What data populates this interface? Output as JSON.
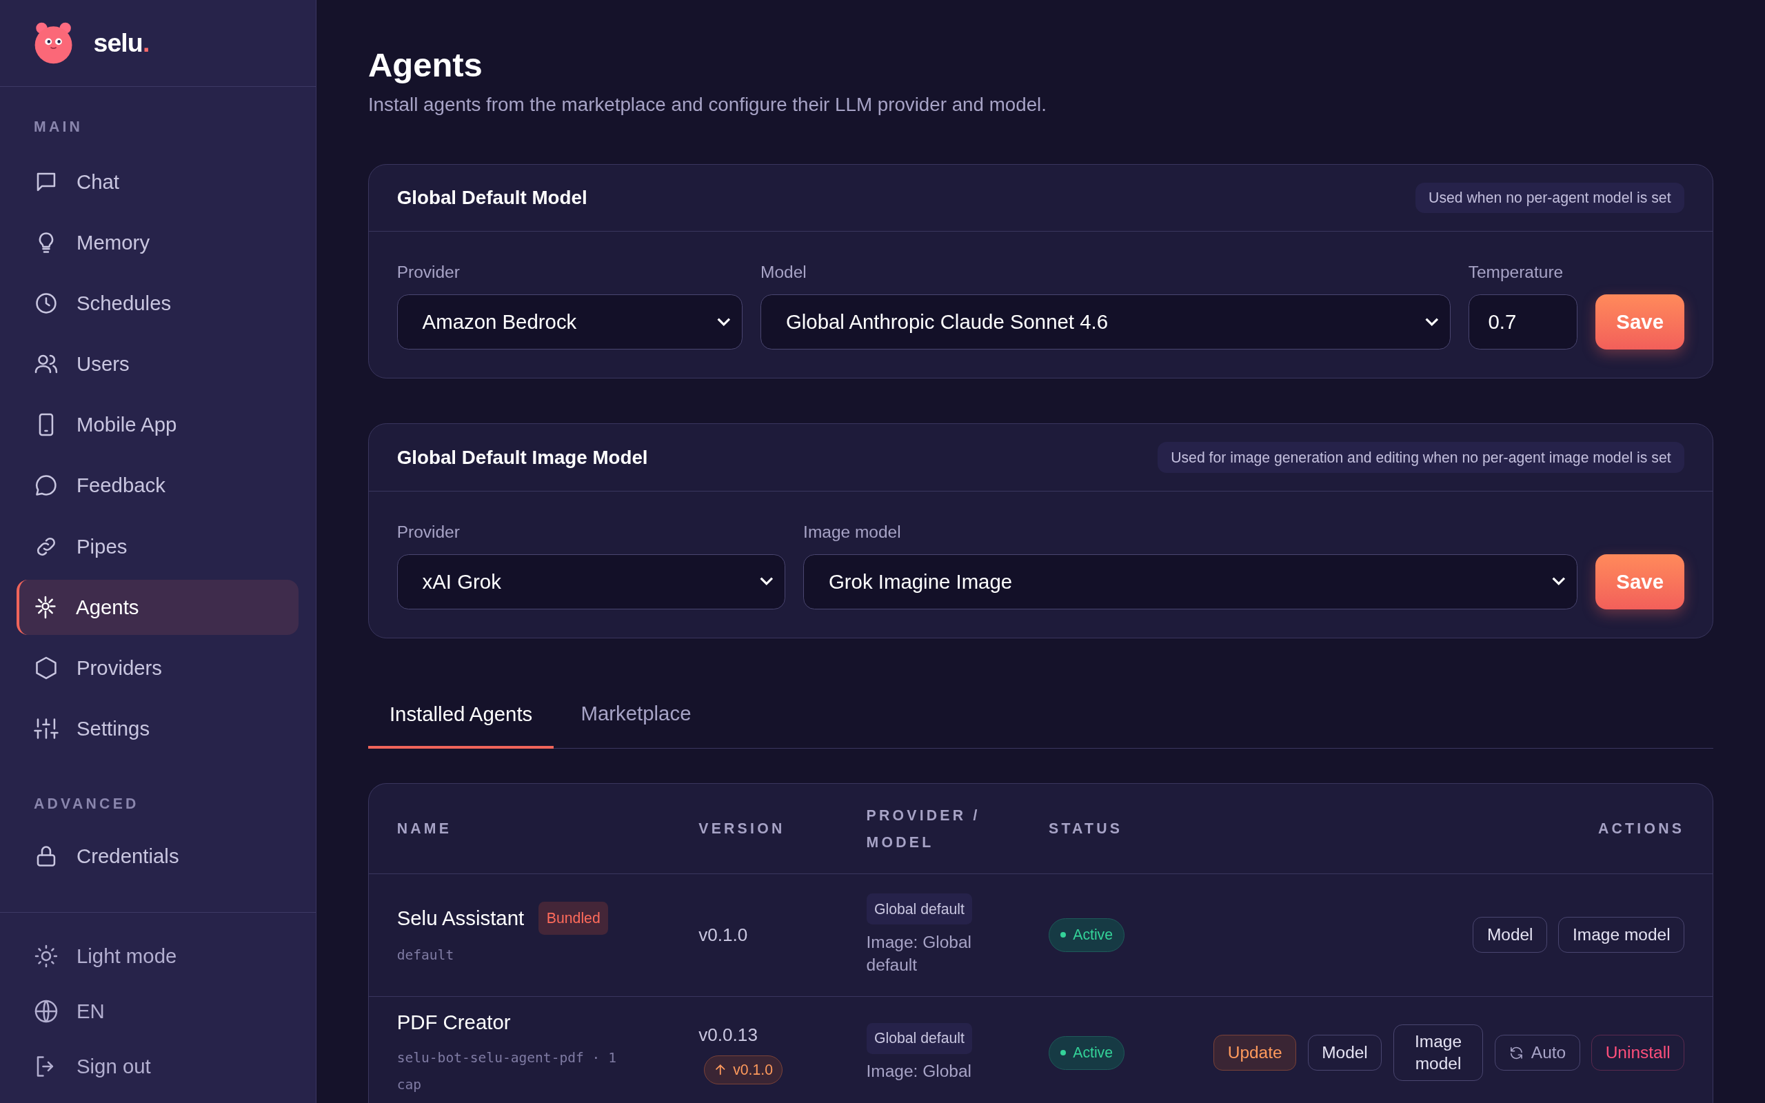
{
  "brand": {
    "name": "selu",
    "mark": "."
  },
  "sidebar": {
    "sections": [
      {
        "label": "MAIN",
        "items": [
          {
            "label": "Chat",
            "selected": false
          },
          {
            "label": "Memory",
            "selected": false
          },
          {
            "label": "Schedules",
            "selected": false
          },
          {
            "label": "Users",
            "selected": false
          },
          {
            "label": "Mobile App",
            "selected": false
          },
          {
            "label": "Feedback",
            "selected": false
          },
          {
            "label": "Pipes",
            "selected": false
          },
          {
            "label": "Agents",
            "selected": true
          },
          {
            "label": "Providers",
            "selected": false
          },
          {
            "label": "Settings",
            "selected": false
          }
        ]
      },
      {
        "label": "ADVANCED",
        "items": [
          {
            "label": "Credentials",
            "selected": false
          }
        ]
      }
    ],
    "footer": [
      {
        "label": "Light mode"
      },
      {
        "label": "EN"
      },
      {
        "label": "Sign out"
      }
    ]
  },
  "page": {
    "title": "Agents",
    "subtitle": "Install agents from the marketplace and configure their LLM provider and model."
  },
  "cards": [
    {
      "title": "Global Default Model",
      "note": "Used when no per-agent model is set",
      "fields": [
        {
          "kind": "select",
          "label": "Provider",
          "value": "Amazon Bedrock"
        },
        {
          "kind": "select",
          "label": "Model",
          "value": "Global Anthropic Claude Sonnet 4.6"
        },
        {
          "kind": "input",
          "label": "Temperature",
          "value": "0.7"
        }
      ],
      "save": "Save"
    },
    {
      "title": "Global Default Image Model",
      "note": "Used for image generation and editing when no per-agent image model is set",
      "fields": [
        {
          "kind": "select",
          "label": "Provider",
          "value": "xAI Grok"
        },
        {
          "kind": "select",
          "label": "Image model",
          "value": "Grok Imagine Image"
        }
      ],
      "save": "Save"
    }
  ],
  "tabs": [
    {
      "label": "Installed Agents",
      "selected": true
    },
    {
      "label": "Marketplace",
      "selected": false
    }
  ],
  "table": {
    "columns": [
      "NAME",
      "VERSION",
      "PROVIDER / MODEL",
      "STATUS",
      "ACTIONS"
    ],
    "rows": [
      {
        "name": "Selu Assistant",
        "badge": "Bundled",
        "slug": "default",
        "version": "v0.1.0",
        "provider": "Global default",
        "image": "Image: Global default",
        "status": "Active",
        "actions": [
          {
            "label": "Model",
            "kind": "neutral"
          },
          {
            "label": "Image model",
            "kind": "neutral"
          }
        ]
      },
      {
        "name": "PDF Creator",
        "slug": "selu-bot-selu-agent-pdf · 1 cap",
        "version": "v0.0.13",
        "update": "v0.1.0",
        "provider": "Global default",
        "image": "Image: Global",
        "status": "Active",
        "actions": [
          {
            "label": "Update",
            "kind": "update"
          },
          {
            "label": "Model",
            "kind": "neutral"
          },
          {
            "label": "Image model",
            "kind": "wrap"
          },
          {
            "label": "Auto",
            "kind": "auto"
          },
          {
            "label": "Uninstall",
            "kind": "danger"
          }
        ]
      }
    ]
  }
}
